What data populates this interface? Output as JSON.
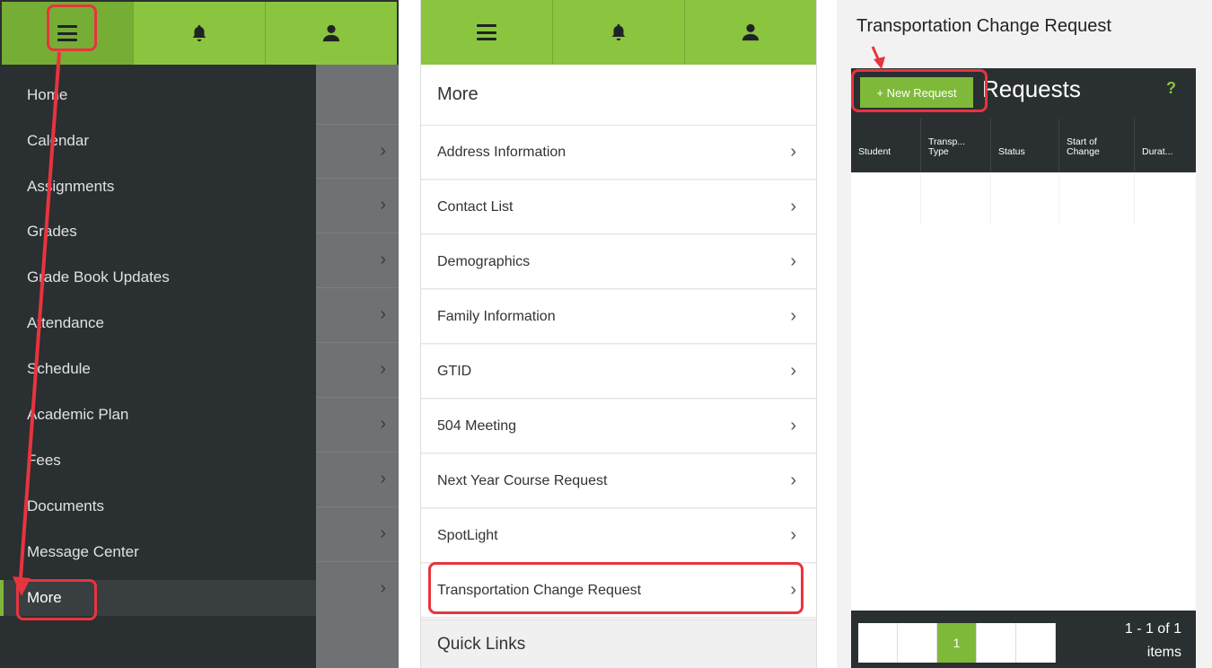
{
  "panel1": {
    "drawer_items": [
      {
        "label": "Home"
      },
      {
        "label": "Calendar"
      },
      {
        "label": "Assignments"
      },
      {
        "label": "Grades"
      },
      {
        "label": "Grade Book Updates"
      },
      {
        "label": "Attendance"
      },
      {
        "label": "Schedule"
      },
      {
        "label": "Academic Plan"
      },
      {
        "label": "Fees"
      },
      {
        "label": "Documents"
      },
      {
        "label": "Message Center"
      },
      {
        "label": "More"
      }
    ]
  },
  "panel2": {
    "heading": "More",
    "items": [
      {
        "label": "Address Information"
      },
      {
        "label": "Contact List"
      },
      {
        "label": "Demographics"
      },
      {
        "label": "Family Information"
      },
      {
        "label": "GTID"
      },
      {
        "label": "504 Meeting"
      },
      {
        "label": "Next Year Course Request"
      },
      {
        "label": "SpotLight"
      },
      {
        "label": "Transportation Change Request"
      }
    ],
    "quick_links": "Quick Links"
  },
  "panel3": {
    "page_title": "Transportation Change Request",
    "new_request_label": "+ New Request",
    "card_title": "Requests",
    "help_label": "?",
    "columns": [
      {
        "label": "Student"
      },
      {
        "label": "Transp...\nType"
      },
      {
        "label": "Status"
      },
      {
        "label": "Start of\nChange"
      },
      {
        "label": "Durat..."
      }
    ],
    "pager": {
      "current_page": "1",
      "range": "1 - 1 of 1",
      "unit": "items"
    }
  },
  "colors": {
    "accent_green": "#8bc53f",
    "dark": "#2a2f31",
    "highlight_red": "#e8343e"
  },
  "icons": [
    "hamburger-menu-icon",
    "bell-icon",
    "user-icon",
    "chevron-right-icon"
  ]
}
